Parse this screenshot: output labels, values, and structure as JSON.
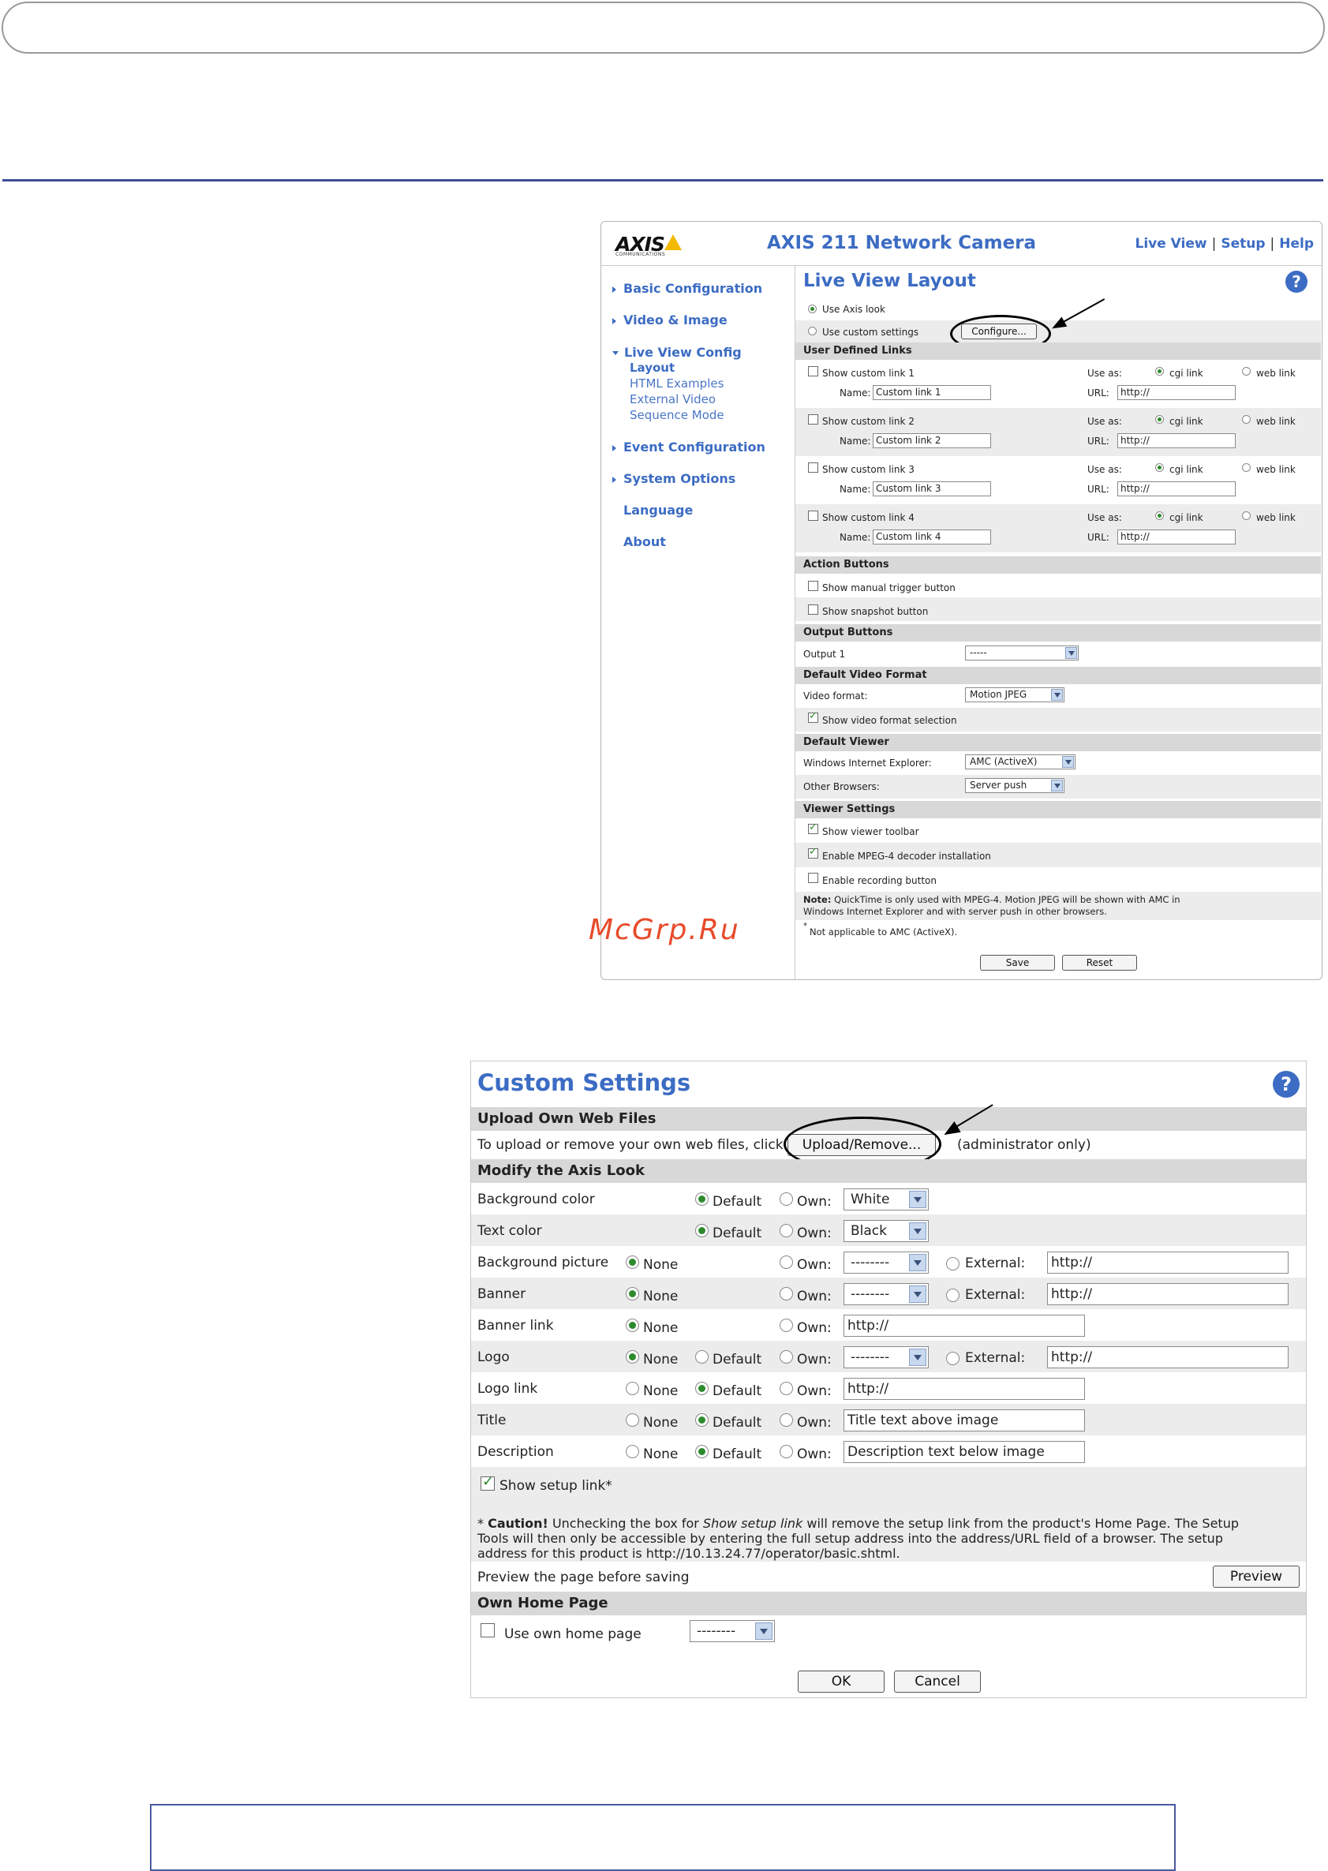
{
  "watermark": "McGrp.Ru",
  "live_view": {
    "logo": "AXIS",
    "logo_sub": "COMMUNICATIONS",
    "product_title": "AXIS 211 Network Camera",
    "top_links": [
      "Live View",
      "Setup",
      "Help"
    ],
    "nav": {
      "items": [
        "Basic Configuration",
        "Video & Image",
        "Live View Config",
        "Event Configuration",
        "System Options",
        "Language",
        "About"
      ],
      "sub_items": [
        "Layout",
        "HTML Examples",
        "External Video",
        "Sequence Mode"
      ]
    },
    "page_title": "Live View Layout",
    "help_glyph": "?",
    "use_axis_look": "Use Axis look",
    "use_custom_settings": "Use custom settings",
    "configure_button": "Configure...",
    "sections": {
      "user_links": "User Defined Links",
      "action_buttons": "Action Buttons",
      "output_buttons": "Output Buttons",
      "default_video_format": "Default Video Format",
      "default_viewer": "Default Viewer",
      "viewer_settings": "Viewer Settings"
    },
    "custom_links": [
      {
        "show_label": "Show custom link 1",
        "name_value": "Custom link 1",
        "url_value": "http://"
      },
      {
        "show_label": "Show custom link 2",
        "name_value": "Custom link 2",
        "url_value": "http://"
      },
      {
        "show_label": "Show custom link 3",
        "name_value": "Custom link 3",
        "url_value": "http://"
      },
      {
        "show_label": "Show custom link 4",
        "name_value": "Custom link 4",
        "url_value": "http://"
      }
    ],
    "name_label": "Name:",
    "url_label": "URL:",
    "use_as_label": "Use as:",
    "cgi_link": "cgi link",
    "web_link": "web link",
    "show_manual_trigger": "Show manual trigger button",
    "show_snapshot": "Show snapshot button",
    "output_label": "Output 1",
    "output_value": "-----",
    "video_format_label": "Video format:",
    "video_format_value": "Motion JPEG",
    "show_video_format_selection": "Show video format selection",
    "windows_ie_label": "Windows Internet Explorer:",
    "windows_ie_value": "AMC (ActiveX)",
    "other_browsers_label": "Other Browsers:",
    "other_browsers_value": "Server push",
    "show_viewer_toolbar": "Show viewer toolbar",
    "enable_mpeg4": "Enable MPEG-4 decoder installation",
    "enable_recording": "Enable recording button",
    "note_label": "Note:",
    "note_line1": "QuickTime is only used with MPEG-4. Motion JPEG will be shown with AMC in",
    "note_line2": "Windows Internet Explorer and with server push in other browsers.",
    "footnote_mark": "*",
    "footnote": "Not applicable to AMC (ActiveX).",
    "save_button": "Save",
    "reset_button": "Reset"
  },
  "custom_settings": {
    "title": "Custom Settings",
    "help_glyph": "?",
    "upload_section": "Upload Own Web Files",
    "upload_text": "To upload or remove your own web files, click",
    "upload_button": "Upload/Remove...",
    "admin_only": "(administrator only)",
    "modify_section": "Modify the Axis Look",
    "labels": {
      "background_color": "Background color",
      "text_color": "Text color",
      "background_picture": "Background picture",
      "banner": "Banner",
      "banner_link": "Banner link",
      "logo": "Logo",
      "logo_link": "Logo link",
      "title": "Title",
      "description": "Description"
    },
    "opt_default": "Default",
    "opt_own": "Own:",
    "opt_none": "None",
    "opt_external": "External:",
    "bg_color_value": "White",
    "text_color_value": "Black",
    "dash_value": "--------",
    "http_value": "http://",
    "title_value": "Title text above image",
    "description_value": "Description text below image",
    "show_setup_link": "Show setup link*",
    "caution_mark": "*",
    "caution_label": "Caution!",
    "caution_text_a": "Unchecking the box for",
    "caution_italic": "Show setup link",
    "caution_text_b": "will remove the setup link from the product's Home Page. The Setup",
    "caution_line2": "Tools will then only be accessible by entering the full setup address into the address/URL field of a browser. The setup",
    "caution_line3": "address for this product is http://10.13.24.77/operator/basic.shtml.",
    "preview_text": "Preview the page before saving",
    "preview_button": "Preview",
    "own_home_section": "Own Home Page",
    "use_own_home": "Use own home page",
    "home_value": "--------",
    "ok_button": "OK",
    "cancel_button": "Cancel"
  },
  "colors": {
    "accent_blue": "#3c6cc3",
    "rule_navy": "#3e4d96",
    "section_gray": "#d8d8d8",
    "radio_green": "#2d8a2d",
    "watermark_red": "#e84a2a"
  }
}
